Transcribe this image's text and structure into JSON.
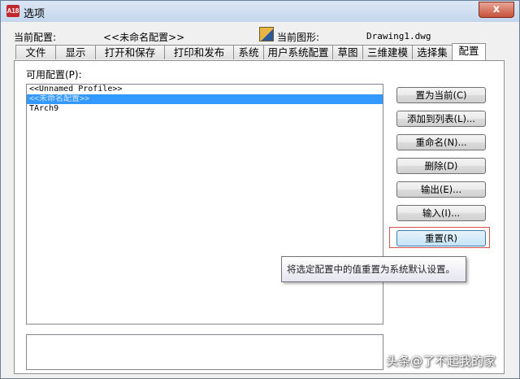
{
  "window": {
    "title": "选项",
    "app_icon_text": "A18",
    "close_label": "x"
  },
  "info": {
    "current_profile_label": "当前配置:",
    "current_profile_value": "<<未命名配置>>",
    "current_drawing_label": "当前图形:",
    "current_drawing_value": "Drawing1.dwg"
  },
  "tabs": [
    {
      "label": "文件"
    },
    {
      "label": "显示"
    },
    {
      "label": "打开和保存"
    },
    {
      "label": "打印和发布"
    },
    {
      "label": "系统"
    },
    {
      "label": "用户系统配置"
    },
    {
      "label": "草图"
    },
    {
      "label": "三维建模"
    },
    {
      "label": "选择集"
    },
    {
      "label": "配置",
      "active": true
    }
  ],
  "profiles": {
    "label": "可用配置(P):",
    "items": [
      {
        "label": "<<Unnamed Profile>>"
      },
      {
        "label": "<<未命名配置>>",
        "selected": true
      },
      {
        "label": "TArch9"
      }
    ]
  },
  "buttons": {
    "set_current": "置为当前(C)",
    "add_to_list": "添加到列表(L)...",
    "rename": "重命名(N)...",
    "delete": "删除(D)",
    "export": "输出(E)...",
    "import": "输入(I)...",
    "reset": "重置(R)"
  },
  "tooltip": "将选定配置中的值重置为系统默认设置。",
  "watermark": "头条@了不起我的家"
}
